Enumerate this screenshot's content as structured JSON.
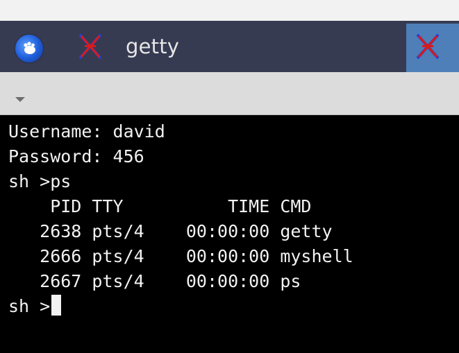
{
  "taskbar": {
    "app_menu_icon": "xfce-mouse-icon",
    "task_icon": "xterm-icon",
    "task_label": "getty",
    "right_task_icon": "xterm-icon"
  },
  "toolbar": {
    "menu_icon": "dropdown-arrow-icon"
  },
  "terminal": {
    "lines": [
      "Username: david",
      "Password: 456",
      "sh >ps",
      "    PID TTY          TIME CMD",
      "   2638 pts/4    00:00:00 getty",
      "   2666 pts/4    00:00:00 myshell",
      "   2667 pts/4    00:00:00 ps"
    ],
    "prompt": "sh >"
  }
}
